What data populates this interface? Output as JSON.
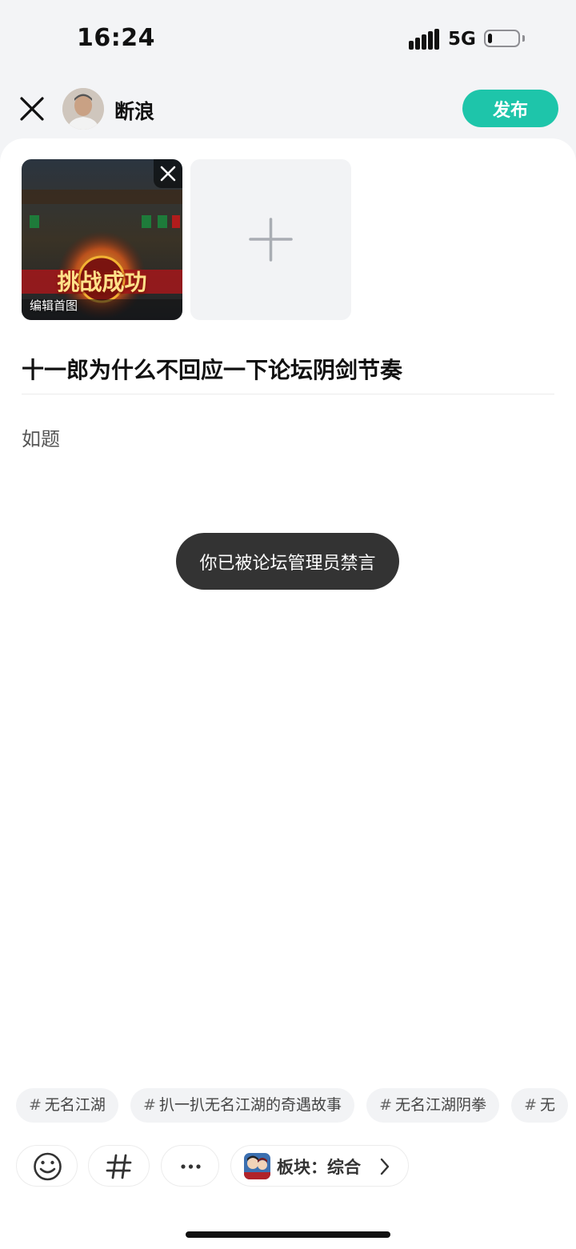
{
  "status_bar": {
    "time": "16:24",
    "network": "5G",
    "battery_level": 0.15
  },
  "header": {
    "username": "断浪",
    "publish_label": "发布"
  },
  "editor": {
    "thumbnail_caption": "编辑首图",
    "thumbnail_banner": "挑战成功",
    "title": "十一郎为什么不回应一下论坛阴剑节奏",
    "body": "如题"
  },
  "toast": {
    "message": "你已被论坛管理员禁言"
  },
  "topics": [
    "无名江湖",
    "扒一扒无名江湖的奇遇故事",
    "无名江湖阴拳",
    "无"
  ],
  "toolbar": {
    "board_label": "板块：综合"
  },
  "colors": {
    "accent": "#1ec5aa",
    "toast_bg": "#333333"
  }
}
